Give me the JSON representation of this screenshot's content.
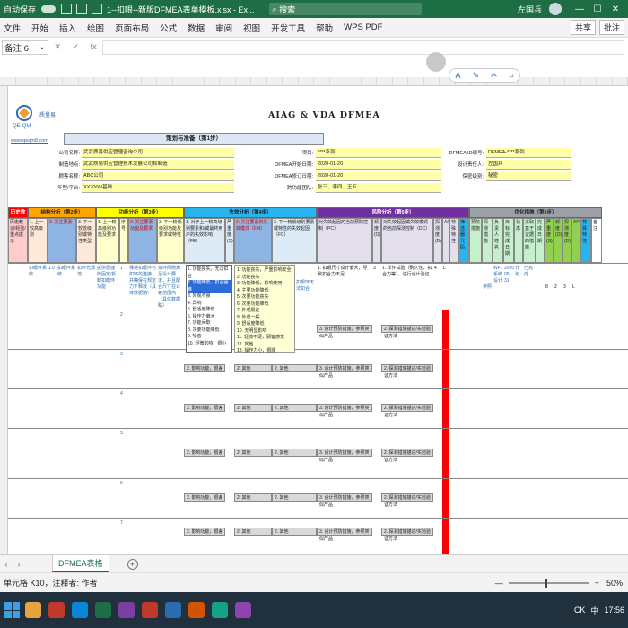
{
  "titlebar": {
    "autosave": "自动保存",
    "filename": "1--扣眼--新版DFMEA表单模板.xlsx - Ex...",
    "search": "搜索",
    "user": "左国兵",
    "minimize": "—",
    "maximize": "☐",
    "close": "✕"
  },
  "menu": [
    "文件",
    "开始",
    "插入",
    "绘图",
    "页面布局",
    "公式",
    "数据",
    "审阅",
    "视图",
    "开发工具",
    "帮助",
    "WPS PDF"
  ],
  "share": "共享",
  "comments": "批注",
  "namebox": "备注 6",
  "fx": "fx",
  "float_toolbar": [
    "A",
    "✎",
    "✂",
    "⌗"
  ],
  "sheet": {
    "logo_text": "QE·QM",
    "company_tag": "质量易",
    "url": "www.qeqm8.com",
    "title": "AIAG & VDA  DFMEA",
    "plan_header": "策划与准备（第1步）",
    "info": {
      "company_label": "公司名称:",
      "company_val": "武武质易供应管理咨询公司",
      "location_label": "制造地点:",
      "location_val": "武武质易供应管理技术发展公司和制造",
      "customer_label": "顾客名称:",
      "customer_val": "ABC公司",
      "model_label": "年型/平台:",
      "model_val": "XX2000/基础",
      "subject_label": "项目:",
      "subject_val": "****系列",
      "start_label": "DFMEA开始日期:",
      "start_val": "2020-01-20",
      "rev_label": "DFMEA修订日期:",
      "rev_val": "2020-01-20",
      "team_label": "跨功能团队:",
      "team_val": "张三、李四、王五",
      "id_label": "DFMEA ID编号:",
      "id_val": "DFMEA-****系列",
      "owner_label": "设计责任人:",
      "owner_val": "左国兵",
      "conf_label": "保密级别:",
      "conf_val": "秘密"
    },
    "groups": {
      "history": "历史教训",
      "structure": "结构分析（第2步）",
      "function": "功能分析（第3步）",
      "failure": "失效分析（第4步）",
      "risk": "风险分析（第5步）",
      "optimize": "优化措施（第6步）"
    },
    "sub_headers": {
      "h1": "历史教训/经验/重点提示",
      "h2": "1. 上一较高级别",
      "h3": "2. 关注要素",
      "h4": "3. 下一较低级别或特性类型",
      "h5": "1. 上一较高级别功能及要求",
      "h6": "序号",
      "h7": "2. 关注要素功能及要求",
      "h8": "3. 下一较低级别功能及要求或特性",
      "h9": "1. 对于上一较高级别要素和/或最终用户的失效影响（FE）",
      "h10": "严重度(S)",
      "h11": "2. 关注要素的失效模式（FM）",
      "h12": "3. 下一较低级别要素或特性的失效起因（FC）",
      "h13": "对失效起因的当前预防控制（PC）",
      "h14": "频度(O)",
      "h15": "对失效起因或失效模式的当前探测控制（DC）",
      "h16": "探测度(D)",
      "h17": "AP",
      "h18": "特殊特性",
      "h19": "筛选器代码",
      "h20": "预防措施",
      "h21": "探测措施",
      "h22": "负责人姓名",
      "h23": "目标完成日期",
      "h24": "状态",
      "h25": "采取基于证据的措施",
      "h26": "完成日期",
      "h27": "严重度(S)",
      "h28": "频度(O)",
      "h29": "探测度(D)",
      "h30": "AP",
      "h31": "特殊特性",
      "h32": "备注"
    },
    "row1": {
      "c_structure": "扣眼环系统",
      "c_level": "1.0",
      "c_focus": "扣眼环系统",
      "c_lower": "扣环光规范",
      "c_func1": "提供便捷的固定/拆卸扣眼环功能",
      "c_seq": "1",
      "c_func2": "保持扣眼环与扣环的连接，并确保在规定力下释放（具体数据略）",
      "c_func3": "扣环间隙满足设计要求，并且配合尺寸在公差范围内（具体数据略）",
      "c_fe": "1. 功能丧失，不能扣合；主要功能丧失，顾客非常不满意",
      "c_sev": "8",
      "c_fm": "扣眼环无法扣合",
      "c_fc": "1. 扣眼尺寸设计偏大，导致扣合力不足",
      "c_pc": "1. 参照相关设计标准，进行公差分析和尺寸链计算",
      "c_occ": "3",
      "c_dc": "1. 样件试验（耐久性、扣合力等），进行设计验证",
      "c_det": "4",
      "c_ap": "L",
      "c_prev": "参照",
      "c_owner": "WF1234系统设计",
      "c_date": "2020-05-31",
      "c_stat": "计划",
      "c_act": "已完成",
      "c_s2": "8",
      "c_o2": "2",
      "c_d2": "3",
      "c_ap2": "L"
    },
    "dropdown": [
      "1. 功能丧失，无法扣合",
      "2. 功能降低，扣合困难",
      "3. 外观不良",
      "4. 异响",
      "5. 舒适度降低",
      "6. 操作力偏大",
      "7. 功能间歇",
      "8. 次要功能降低",
      "9. 噪音",
      "10. 轻微影响，很小"
    ],
    "tooltip": [
      "1. 功能丧失，严重影响安全",
      "2. 功能丧失",
      "3. 功能降低，影响使用",
      "4. 主要功能降低",
      "5. 次要功能丧失",
      "6. 次要功能降低",
      "7. 外观很差",
      "8. 外观一般",
      "9. 舒适度降低",
      "10. 无明显影响",
      "11. 轻微不便，顾客感觉",
      "12. 其他",
      "13. 操作力小，很顺"
    ],
    "rep_fe": "2. 影响功能，很差",
    "rep_fm": "2. 其他",
    "rep_fc": "2. 其他",
    "rep_pc": "3. 设计预防措施，参照类似产品",
    "rep_dc": "2. 探测措施描述/实验验证方法",
    "rep_seq2": "2",
    "rep_seq3": "3",
    "rep_seq4": "4",
    "rep_seq5": "5",
    "rep_seq6": "6",
    "rep_seq7": "7"
  },
  "sheet_tab": "DFMEA表格",
  "add_sheet": "+",
  "status": {
    "cell": "单元格 K10，注释者: 作者",
    "zoom_minus": "—",
    "zoom_plus": "+",
    "zoom": "50%"
  },
  "taskbar": {
    "time": "17:56",
    "ime": "中",
    "lang": "CK"
  }
}
